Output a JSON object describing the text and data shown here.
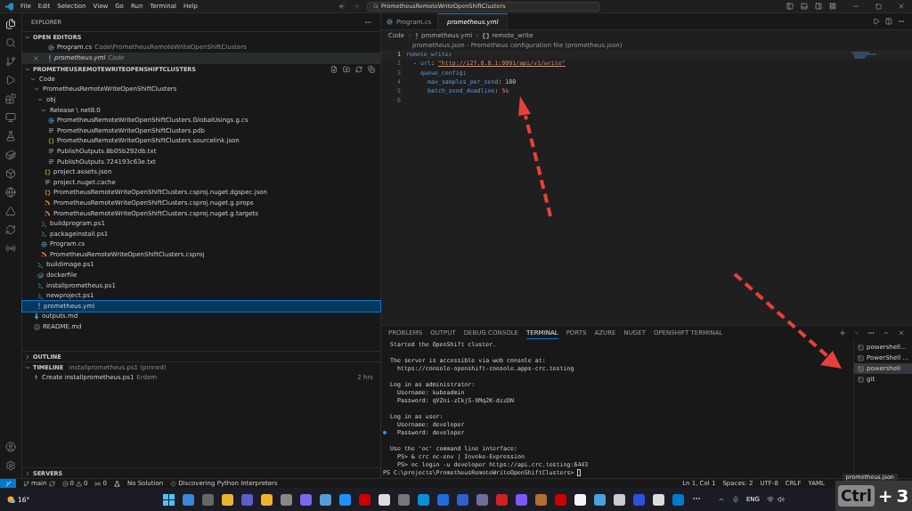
{
  "menu": [
    "File",
    "Edit",
    "Selection",
    "View",
    "Go",
    "Run",
    "Terminal",
    "Help"
  ],
  "command_center": "PrometheusRemoteWriteOpenShiftClusters",
  "sidebar": {
    "title": "EXPLORER",
    "open_editors": {
      "title": "OPEN EDITORS",
      "expanded": true,
      "items": [
        {
          "name": "Program.cs",
          "path": "Code\\PrometheusRemoteWriteOpenShiftClusters",
          "kind": "cs",
          "selected": false
        },
        {
          "name": "prometheus.yml",
          "path": "Code",
          "kind": "yml",
          "selected": true
        }
      ]
    },
    "folder": {
      "title": "PROMETHEUSREMOTEWRITEOPENSHIFTCLUSTERS",
      "expanded": true,
      "tree": [
        {
          "name": "Code",
          "kind": "folder",
          "expanded": true,
          "selected": false,
          "children": [
            {
              "name": "PrometheusRemoteWriteOpenShiftClusters",
              "kind": "folder",
              "expanded": true,
              "selected": false,
              "children": [
                {
                  "name": "obj",
                  "kind": "folder",
                  "expanded": true,
                  "selected": false,
                  "children": [
                    {
                      "name": "Release \\ net8.0",
                      "kind": "folder",
                      "expanded": true,
                      "selected": false,
                      "children": [
                        {
                          "name": "PrometheusRemoteWriteOpenShiftClusters.GlobalUsings.g.cs",
                          "kind": "cs",
                          "selected": false
                        },
                        {
                          "name": "PrometheusRemoteWriteOpenShiftClusters.pdb",
                          "kind": "text",
                          "selected": false
                        },
                        {
                          "name": "PrometheusRemoteWriteOpenShiftClusters.sourcelink.json",
                          "kind": "json",
                          "selected": false
                        },
                        {
                          "name": "PublishOutputs.8b05b292db.txt",
                          "kind": "text",
                          "selected": false
                        },
                        {
                          "name": "PublishOutputs.724193c63e.txt",
                          "kind": "text",
                          "selected": false
                        }
                      ]
                    },
                    {
                      "name": "project.assets.json",
                      "kind": "json",
                      "selected": false
                    },
                    {
                      "name": "project.nuget.cache",
                      "kind": "text",
                      "selected": false
                    },
                    {
                      "name": "PrometheusRemoteWriteOpenShiftClusters.csproj.nuget.dgspec.json",
                      "kind": "json",
                      "selected": false
                    },
                    {
                      "name": "PrometheusRemoteWriteOpenShiftClusters.csproj.nuget.g.props",
                      "kind": "xml",
                      "selected": false
                    },
                    {
                      "name": "PrometheusRemoteWriteOpenShiftClusters.csproj.nuget.g.targets",
                      "kind": "xml",
                      "selected": false
                    }
                  ]
                },
                {
                  "name": "buildprogram.ps1",
                  "kind": "ps1",
                  "selected": false
                },
                {
                  "name": "packageinstall.ps1",
                  "kind": "ps1",
                  "selected": false
                },
                {
                  "name": "Program.cs",
                  "kind": "cs",
                  "selected": false
                },
                {
                  "name": "PrometheusRemoteWriteOpenShiftClusters.csproj",
                  "kind": "xml",
                  "selected": false
                }
              ]
            },
            {
              "name": "buildimage.ps1",
              "kind": "ps1",
              "selected": false
            },
            {
              "name": "dockerfile",
              "kind": "docker",
              "selected": false
            },
            {
              "name": "installprometheus.ps1",
              "kind": "ps1",
              "selected": false
            },
            {
              "name": "newproject.ps1",
              "kind": "ps1",
              "selected": false
            },
            {
              "name": "prometheus.yml",
              "kind": "yml",
              "selected": true
            }
          ]
        },
        {
          "name": "outputs.md",
          "kind": "md",
          "selected": false
        },
        {
          "name": "README.md",
          "kind": "info",
          "selected": false
        }
      ]
    },
    "outline": {
      "title": "OUTLINE",
      "expanded": false
    },
    "timeline": {
      "title": "TIMELINE",
      "context": "installprometheus.ps1 (pinned)",
      "expanded": true,
      "items": [
        {
          "label": "Create installprometheus.ps1",
          "author": "Erdem",
          "time": "2 hrs"
        }
      ]
    },
    "servers": {
      "title": "SERVERS",
      "expanded": false
    }
  },
  "editor": {
    "tabs": [
      {
        "name": "Program.cs",
        "kind": "cs",
        "selected": false
      },
      {
        "name": "prometheus.yml",
        "kind": "yml",
        "selected": true
      }
    ],
    "breadcrumb": [
      "Code",
      "prometheus.yml",
      "remote_write"
    ],
    "schema_hint": "prometheus.json - Prometheus configuration file (prometheus.json)",
    "lines": [
      {
        "number": "1",
        "kind": "root",
        "tokens": [
          {
            "text": "remote_write",
            "kind": "key"
          },
          {
            "text": ":",
            "kind": "punct"
          }
        ]
      },
      {
        "number": "2",
        "kind": "item",
        "tokens": [
          {
            "text": "- ",
            "kind": "punct"
          },
          {
            "text": "url",
            "kind": "key"
          },
          {
            "text": ": ",
            "kind": "punct"
          },
          {
            "text": "\"http://127.0.0.1:9091/api/v1/write\"",
            "kind": "link"
          }
        ]
      },
      {
        "number": "3",
        "kind": "child",
        "tokens": [
          {
            "text": "queue_config",
            "kind": "key"
          },
          {
            "text": ":",
            "kind": "punct"
          }
        ]
      },
      {
        "number": "4",
        "kind": "grandchild",
        "tokens": [
          {
            "text": "max_samples_per_send",
            "kind": "key"
          },
          {
            "text": ": ",
            "kind": "punct"
          },
          {
            "text": "100",
            "kind": "number"
          }
        ]
      },
      {
        "number": "5",
        "kind": "grandchild",
        "tokens": [
          {
            "text": "batch_send_deadline",
            "kind": "key"
          },
          {
            "text": ": ",
            "kind": "punct"
          },
          {
            "text": "5s",
            "kind": "string"
          }
        ]
      },
      {
        "number": "6"
      }
    ]
  },
  "panel": {
    "tabs": [
      {
        "label": "PROBLEMS",
        "selected": false
      },
      {
        "label": "OUTPUT",
        "selected": false
      },
      {
        "label": "DEBUG CONSOLE",
        "selected": false
      },
      {
        "label": "TERMINAL",
        "selected": true
      },
      {
        "label": "PORTS",
        "selected": false
      },
      {
        "label": "AZURE",
        "selected": false
      },
      {
        "label": "NUGET",
        "selected": false
      },
      {
        "label": "OPENSHIFT TERMINAL",
        "selected": false
      }
    ],
    "terminal": [
      [
        {
          "text": "Started the OpenShift cluster.",
          "decorated": false
        }
      ],
      [
        {
          "text": "The server is accessible via web console at:",
          "decorated": false
        },
        {
          "text": "  https://console-openshift-console.apps-crc.testing",
          "decorated": false
        }
      ],
      [
        {
          "text": "Log in as administrator:",
          "decorated": false
        },
        {
          "text": "  Username: kubeadmin",
          "decorated": false
        },
        {
          "text": "  Password: qVZni-zCkjS-XMq2K-dzzDN",
          "decorated": false
        }
      ],
      [
        {
          "text": "Log in as user:",
          "decorated": false
        },
        {
          "text": "  Username: developer",
          "decorated": false
        },
        {
          "text": "  Password: developer",
          "decorated": true
        }
      ],
      [
        {
          "text": "Use the 'oc' command line interface:",
          "decorated": false
        },
        {
          "text": "  PS> & crc oc-env | Invoke-Expression",
          "decorated": false
        },
        {
          "text": "  PS> oc login -u developer https://api.crc.testing:6443",
          "decorated": false
        }
      ]
    ],
    "prompt": "PS C:\\projects\\PrometheusRemoteWriteOpenShiftClusters>",
    "terminals": [
      {
        "name": "powershell...",
        "selected": false
      },
      {
        "name": "PowerShell ...",
        "selected": false
      },
      {
        "name": "powershell",
        "selected": true
      },
      {
        "name": "git",
        "selected": false
      }
    ]
  },
  "status_bar": {
    "branch": "main",
    "errors": "0",
    "warnings": "0",
    "ports": "0",
    "solution": "No Solution",
    "progress": "Discovering Python Interpreters",
    "right": [
      "Ln 1, Col 1",
      "Spaces: 2",
      "UTF-8",
      "CRLF",
      "YAML"
    ]
  },
  "taskbar": {
    "weather": "16°",
    "language": "ENG"
  },
  "toast": "prometheus.json",
  "keys": {
    "modifier": "Ctrl",
    "plus": "+",
    "key": "3"
  }
}
